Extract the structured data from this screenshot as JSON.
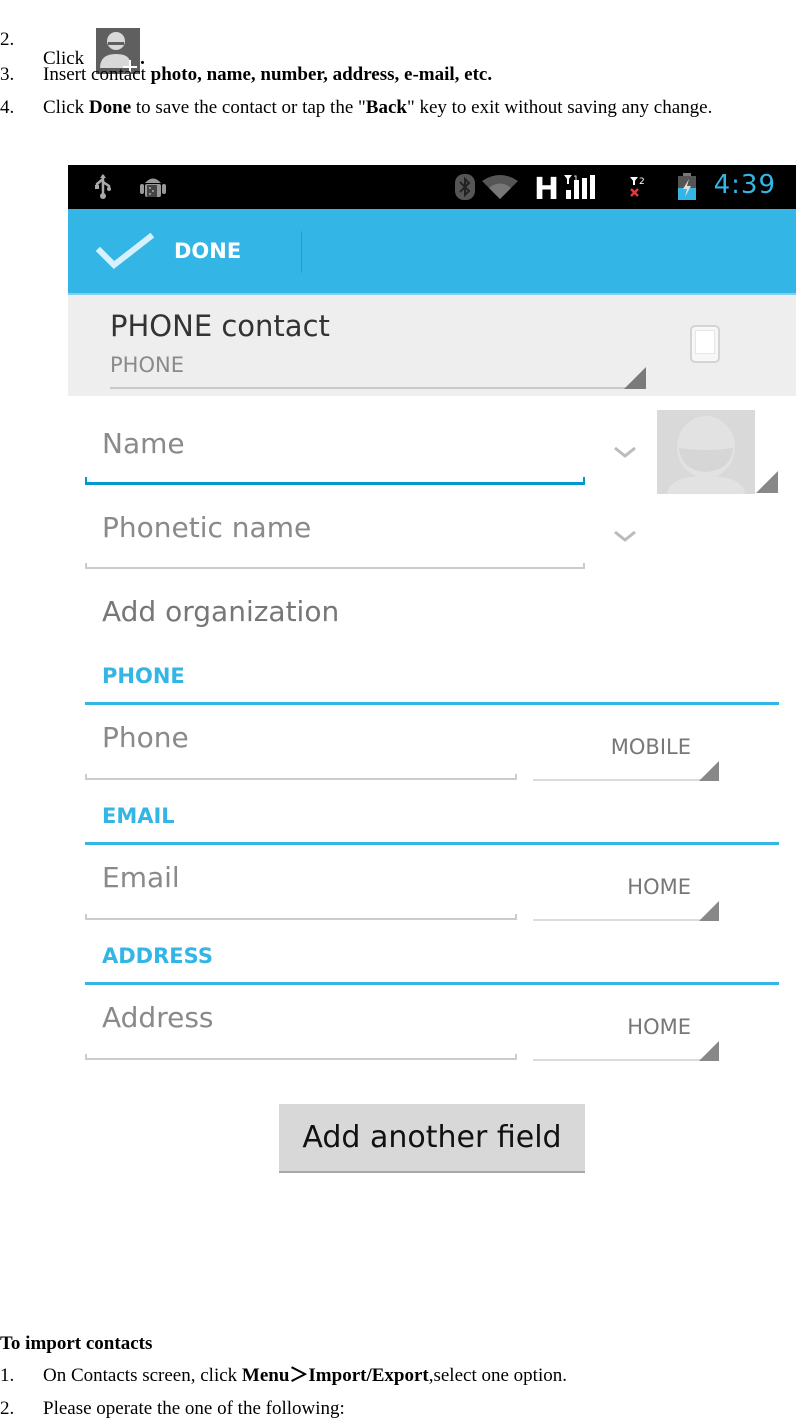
{
  "document": {
    "steps_top": [
      {
        "num": "2.",
        "text_before": "Click",
        "icon": "add-contact-icon",
        "text_after": "."
      },
      {
        "num": "3.",
        "text_before": "Insert contact ",
        "bold": "photo, name, number, address, e-mail, etc.",
        "text_after": ""
      },
      {
        "num": "4.",
        "text_before": "Click ",
        "bold": "Done",
        "text_mid": " to save the contact or tap the \"",
        "bold2": "Back",
        "text_after": "\" key to exit without saving any change."
      }
    ],
    "import_heading": "To import contacts",
    "steps_bottom": [
      {
        "num": "1.",
        "text_before": "On Contacts screen, click ",
        "bold": "Menu＞Import/Export",
        "text_after": ",select one option."
      },
      {
        "num": "2.",
        "text_before": "Please operate the one of the following:"
      }
    ]
  },
  "phone": {
    "status_bar": {
      "left_icons": [
        "usb-icon",
        "android-debug-icon"
      ],
      "right_icons": [
        "bluetooth-icon",
        "wifi-icon",
        "hspa-signal-icon",
        "sim2-no-signal-icon",
        "battery-charging-icon"
      ],
      "network_type": "H",
      "sim1_label": "1",
      "sim2_label": "2",
      "time": "4:39"
    },
    "action_bar": {
      "done_label": "DONE",
      "done_icon": "checkmark-icon"
    },
    "account": {
      "name": "PHONE contact",
      "type": "PHONE",
      "icon": "phone-device-icon"
    },
    "fields": {
      "name_placeholder": "Name",
      "phonetic_placeholder": "Phonetic name",
      "add_organization": "Add organization"
    },
    "sections": [
      {
        "header": "PHONE",
        "placeholder": "Phone",
        "type": "MOBILE"
      },
      {
        "header": "EMAIL",
        "placeholder": "Email",
        "type": "HOME"
      },
      {
        "header": "ADDRESS",
        "placeholder": "Address",
        "type": "HOME"
      }
    ],
    "add_field_button": "Add another field",
    "colors": {
      "accent": "#33b5e5",
      "focus": "#0099cc",
      "status_bar": "#000000",
      "account_band": "#eeeeee"
    }
  }
}
